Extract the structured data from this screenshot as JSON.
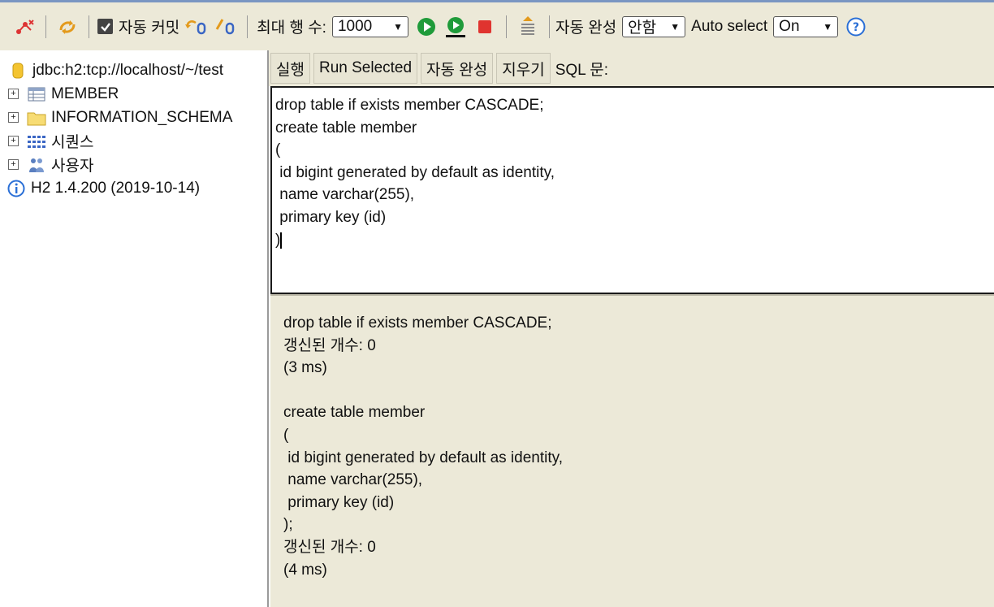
{
  "toolbar": {
    "auto_commit_label": "자동 커밋",
    "max_rows_label": "최대 행 수:",
    "max_rows_value": "1000",
    "autocomplete_label": "자동 완성",
    "autocomplete_value": "안함",
    "auto_select_label": "Auto select",
    "auto_select_value": "On",
    "icons": [
      "disconnect-icon",
      "refresh-icon",
      "rollback-icon",
      "commit-icon",
      "run-icon",
      "run-selected-icon",
      "stop-icon",
      "history-icon",
      "help-icon"
    ]
  },
  "tree": {
    "connection": "jdbc:h2:tcp://localhost/~/test",
    "items": [
      {
        "label": "MEMBER",
        "icon": "table-icon"
      },
      {
        "label": "INFORMATION_SCHEMA",
        "icon": "folder-icon"
      },
      {
        "label": "시퀀스",
        "icon": "sequence-icon"
      },
      {
        "label": "사용자",
        "icon": "users-icon"
      }
    ],
    "version": "H2 1.4.200 (2019-10-14)"
  },
  "sqlbar": {
    "run_label": "실행",
    "run_selected_label": "Run Selected",
    "autocomplete_label": "자동 완성",
    "clear_label": "지우기",
    "sql_label": "SQL 문:"
  },
  "editor": {
    "lines": [
      "drop table if exists member CASCADE;",
      "create table member",
      "(",
      " id bigint generated by default as identity,",
      " name varchar(255),",
      " primary key (id)",
      ")"
    ]
  },
  "result": {
    "lines": [
      "drop table if exists member CASCADE;",
      "갱신된 개수: 0",
      "(3 ms)",
      "",
      "create table member",
      "(",
      " id bigint generated by default as identity,",
      " name varchar(255),",
      " primary key (id)",
      ");",
      "갱신된 개수: 0",
      "(4 ms)"
    ]
  },
  "colors": {
    "toolbar_bg": "#ece9d8",
    "run_green": "#1f9b3a",
    "stop_red": "#e0342f",
    "help_blue": "#2a6fd6"
  }
}
